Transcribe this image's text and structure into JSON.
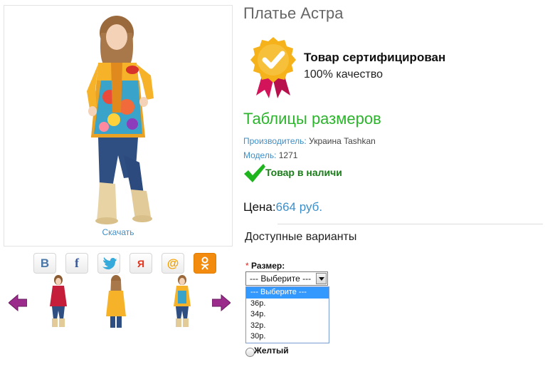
{
  "product": {
    "title": "Платье Астра",
    "download": "Скачать"
  },
  "certificate": {
    "title": "Товар сертифицирован",
    "subtitle": "100% качество"
  },
  "size_tables_link": "Таблицы размеров",
  "meta": {
    "manufacturer_label": "Производитель:",
    "manufacturer_value": "Украина Tashkan",
    "model_label": "Модель:",
    "model_value": "1271"
  },
  "stock": {
    "text": "Товар в наличи"
  },
  "price": {
    "label": "Цена:",
    "value": "664 руб."
  },
  "variants": {
    "title": "Доступные варианты",
    "size_label": "Размер:",
    "required_mark": "*",
    "size_select": {
      "selected": "--- Выберите ---",
      "options": [
        "--- Выберите ---",
        "36р.",
        "34р.",
        "32р.",
        "30р."
      ]
    },
    "color_option": "Желтый"
  },
  "share": {
    "buttons": [
      "vk-icon",
      "facebook-icon",
      "twitter-icon",
      "odnoklassniki-icon",
      "mailru-icon",
      "ok-icon"
    ]
  },
  "colors": {
    "accent_green": "#2cb52c",
    "link_blue": "#3d8fc7",
    "badge_gold": "#f5b21a",
    "badge_ribbon": "#d4145a",
    "arrow_purple": "#9b2c8c"
  }
}
